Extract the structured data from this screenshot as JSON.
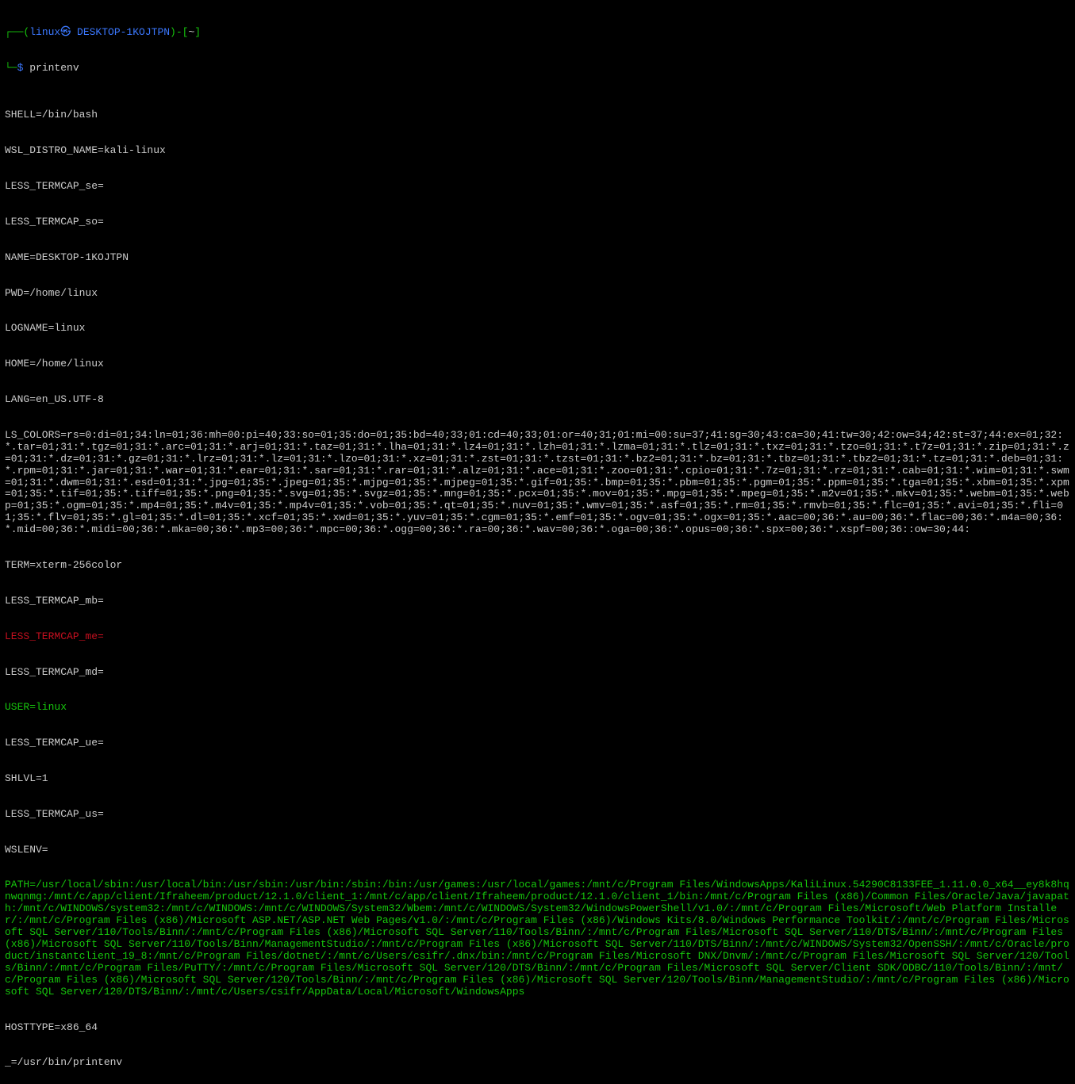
{
  "prompt": {
    "l1a": "┌──(",
    "l1b": "linux㉿ DESKTOP-1KOJTPN",
    "l1c": ")-[",
    "l1d": "~",
    "l1e": "]",
    "l2a": "└─",
    "l2b": "$ ",
    "cmd": "printenv"
  },
  "out": {
    "SHELL": "SHELL=/bin/bash",
    "WSL_DISTRO_NAME": "WSL_DISTRO_NAME=kali-linux",
    "LESS_TERMCAP_se": "LESS_TERMCAP_se=",
    "LESS_TERMCAP_so": "LESS_TERMCAP_so=",
    "NAME": "NAME=DESKTOP-1KOJTPN",
    "PWD": "PWD=/home/linux",
    "LOGNAME": "LOGNAME=linux",
    "HOME": "HOME=/home/linux",
    "LANG": "LANG=en_US.UTF-8",
    "LS_COLORS": "LS_COLORS=rs=0:di=01;34:ln=01;36:mh=00:pi=40;33:so=01;35:do=01;35:bd=40;33;01:cd=40;33;01:or=40;31;01:mi=00:su=37;41:sg=30;43:ca=30;41:tw=30;42:ow=34;42:st=37;44:ex=01;32:*.tar=01;31:*.tgz=01;31:*.arc=01;31:*.arj=01;31:*.taz=01;31:*.lha=01;31:*.lz4=01;31:*.lzh=01;31:*.lzma=01;31:*.tlz=01;31:*.txz=01;31:*.tzo=01;31:*.t7z=01;31:*.zip=01;31:*.z=01;31:*.dz=01;31:*.gz=01;31:*.lrz=01;31:*.lz=01;31:*.lzo=01;31:*.xz=01;31:*.zst=01;31:*.tzst=01;31:*.bz2=01;31:*.bz=01;31:*.tbz=01;31:*.tbz2=01;31:*.tz=01;31:*.deb=01;31:*.rpm=01;31:*.jar=01;31:*.war=01;31:*.ear=01;31:*.sar=01;31:*.rar=01;31:*.alz=01;31:*.ace=01;31:*.zoo=01;31:*.cpio=01;31:*.7z=01;31:*.rz=01;31:*.cab=01;31:*.wim=01;31:*.swm=01;31:*.dwm=01;31:*.esd=01;31:*.jpg=01;35:*.jpeg=01;35:*.mjpg=01;35:*.mjpeg=01;35:*.gif=01;35:*.bmp=01;35:*.pbm=01;35:*.pgm=01;35:*.ppm=01;35:*.tga=01;35:*.xbm=01;35:*.xpm=01;35:*.tif=01;35:*.tiff=01;35:*.png=01;35:*.svg=01;35:*.svgz=01;35:*.mng=01;35:*.pcx=01;35:*.mov=01;35:*.mpg=01;35:*.mpeg=01;35:*.m2v=01;35:*.mkv=01;35:*.webm=01;35:*.webp=01;35:*.ogm=01;35:*.mp4=01;35:*.m4v=01;35:*.mp4v=01;35:*.vob=01;35:*.qt=01;35:*.nuv=01;35:*.wmv=01;35:*.asf=01;35:*.rm=01;35:*.rmvb=01;35:*.flc=01;35:*.avi=01;35:*.fli=01;35:*.flv=01;35:*.gl=01;35:*.dl=01;35:*.xcf=01;35:*.xwd=01;35:*.yuv=01;35:*.cgm=01;35:*.emf=01;35:*.ogv=01;35:*.ogx=01;35:*.aac=00;36:*.au=00;36:*.flac=00;36:*.m4a=00;36:*.mid=00;36:*.midi=00;36:*.mka=00;36:*.mp3=00;36:*.mpc=00;36:*.ogg=00;36:*.ra=00;36:*.wav=00;36:*.oga=00;36:*.opus=00;36:*.spx=00;36:*.xspf=00;36::ow=30;44:",
    "TERM": "TERM=xterm-256color",
    "LESS_TERMCAP_mb": "LESS_TERMCAP_mb=",
    "LESS_TERMCAP_me": "LESS_TERMCAP_me=",
    "LESS_TERMCAP_md": "LESS_TERMCAP_md=",
    "USER": "USER=linux",
    "LESS_TERMCAP_ue": "LESS_TERMCAP_ue=",
    "SHLVL": "SHLVL=1",
    "LESS_TERMCAP_us": "LESS_TERMCAP_us=",
    "WSLENV": "WSLENV=",
    "PATH": "PATH=/usr/local/sbin:/usr/local/bin:/usr/sbin:/usr/bin:/sbin:/bin:/usr/games:/usr/local/games:/mnt/c/Program Files/WindowsApps/KaliLinux.54290C8133FEE_1.11.0.0_x64__ey8k8hqnwqnmg:/mnt/c/app/client/Ifraheem/product/12.1.0/client_1:/mnt/c/app/client/Ifraheem/product/12.1.0/client_1/bin:/mnt/c/Program Files (x86)/Common Files/Oracle/Java/javapath:/mnt/c/WINDOWS/system32:/mnt/c/WINDOWS:/mnt/c/WINDOWS/System32/Wbem:/mnt/c/WINDOWS/System32/WindowsPowerShell/v1.0/:/mnt/c/Program Files/Microsoft/Web Platform Installer/:/mnt/c/Program Files (x86)/Microsoft ASP.NET/ASP.NET Web Pages/v1.0/:/mnt/c/Program Files (x86)/Windows Kits/8.0/Windows Performance Toolkit/:/mnt/c/Program Files/Microsoft SQL Server/110/Tools/Binn/:/mnt/c/Program Files (x86)/Microsoft SQL Server/110/Tools/Binn/:/mnt/c/Program Files/Microsoft SQL Server/110/DTS/Binn/:/mnt/c/Program Files (x86)/Microsoft SQL Server/110/Tools/Binn/ManagementStudio/:/mnt/c/Program Files (x86)/Microsoft SQL Server/110/DTS/Binn/:/mnt/c/WINDOWS/System32/OpenSSH/:/mnt/c/Oracle/product/instantclient_19_8:/mnt/c/Program Files/dotnet/:/mnt/c/Users/csifr/.dnx/bin:/mnt/c/Program Files/Microsoft DNX/Dnvm/:/mnt/c/Program Files/Microsoft SQL Server/120/Tools/Binn/:/mnt/c/Program Files/PuTTY/:/mnt/c/Program Files/Microsoft SQL Server/120/DTS/Binn/:/mnt/c/Program Files/Microsoft SQL Server/Client SDK/ODBC/110/Tools/Binn/:/mnt/c/Program Files (x86)/Microsoft SQL Server/120/Tools/Binn/:/mnt/c/Program Files (x86)/Microsoft SQL Server/120/Tools/Binn/ManagementStudio/:/mnt/c/Program Files (x86)/Microsoft SQL Server/120/DTS/Binn/:/mnt/c/Users/csifr/AppData/Local/Microsoft/WindowsApps",
    "HOSTTYPE": "HOSTTYPE=x86_64",
    "UNDERSCORE": "_=/usr/bin/printenv"
  }
}
